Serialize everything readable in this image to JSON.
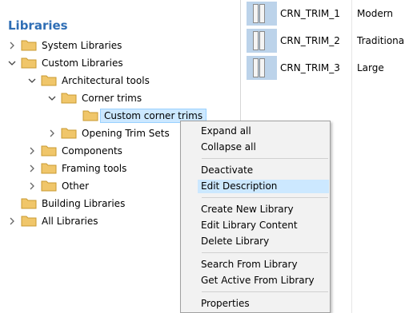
{
  "tree": {
    "title": "Libraries",
    "nodes": [
      {
        "label": "System Libraries",
        "expander": "collapsed"
      },
      {
        "label": "Custom Libraries",
        "expander": "expanded"
      },
      {
        "label": "Architectural tools",
        "expander": "expanded"
      },
      {
        "label": "Corner trims",
        "expander": "expanded"
      },
      {
        "label": "Custom corner trims",
        "expander": "none",
        "selected": true
      },
      {
        "label": "Opening Trim Sets",
        "expander": "collapsed"
      },
      {
        "label": "Components",
        "expander": "collapsed"
      },
      {
        "label": "Framing tools",
        "expander": "collapsed"
      },
      {
        "label": "Other",
        "expander": "collapsed"
      },
      {
        "label": "Building Libraries",
        "expander": "none"
      },
      {
        "label": "All Libraries",
        "expander": "collapsed"
      }
    ]
  },
  "list": {
    "items": [
      {
        "name": "CRN_TRIM_1",
        "description": "Modern"
      },
      {
        "name": "CRN_TRIM_2",
        "description": "Traditional"
      },
      {
        "name": "CRN_TRIM_3",
        "description": "Large"
      }
    ]
  },
  "context_menu": {
    "items": [
      {
        "label": "Expand all"
      },
      {
        "label": "Collapse all"
      },
      {
        "label": "Deactivate"
      },
      {
        "label": "Edit Description",
        "highlighted": true
      },
      {
        "label": "Create New Library"
      },
      {
        "label": "Edit Library Content"
      },
      {
        "label": "Delete Library"
      },
      {
        "label": "Search From Library"
      },
      {
        "label": "Get Active From Library"
      },
      {
        "label": "Properties"
      }
    ]
  },
  "colors": {
    "title": "#2f6eb5",
    "selection": "#cce8ff",
    "folder": "#f0c66a",
    "thumbnail": "#bcd3ea"
  }
}
